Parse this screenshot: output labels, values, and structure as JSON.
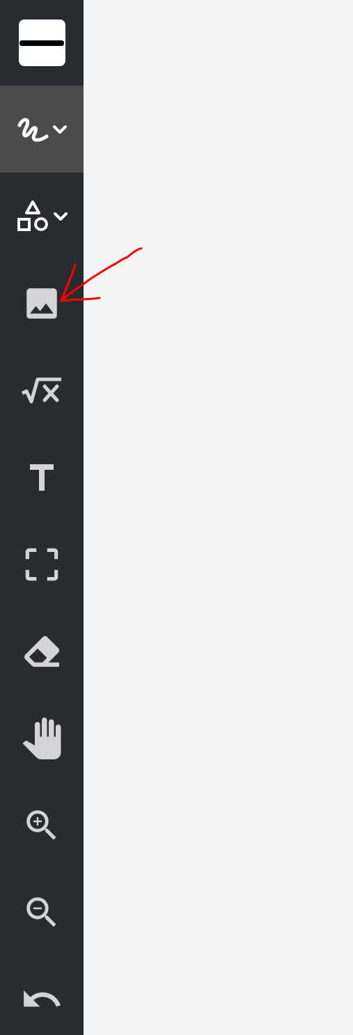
{
  "tools": [
    {
      "kind": "pen",
      "selected": true,
      "has_dropdown": true
    },
    {
      "kind": "shapes",
      "selected": false,
      "has_dropdown": true
    },
    {
      "kind": "image",
      "selected": false,
      "has_dropdown": false
    },
    {
      "kind": "math",
      "selected": false,
      "has_dropdown": false
    },
    {
      "kind": "text",
      "selected": false,
      "has_dropdown": false
    },
    {
      "kind": "select",
      "selected": false,
      "has_dropdown": false
    },
    {
      "kind": "eraser",
      "selected": false,
      "has_dropdown": false
    },
    {
      "kind": "pan",
      "selected": false,
      "has_dropdown": false
    },
    {
      "kind": "zoom_in",
      "selected": false,
      "has_dropdown": false
    },
    {
      "kind": "zoom_out",
      "selected": false,
      "has_dropdown": false
    },
    {
      "kind": "undo",
      "selected": false,
      "has_dropdown": false
    }
  ]
}
